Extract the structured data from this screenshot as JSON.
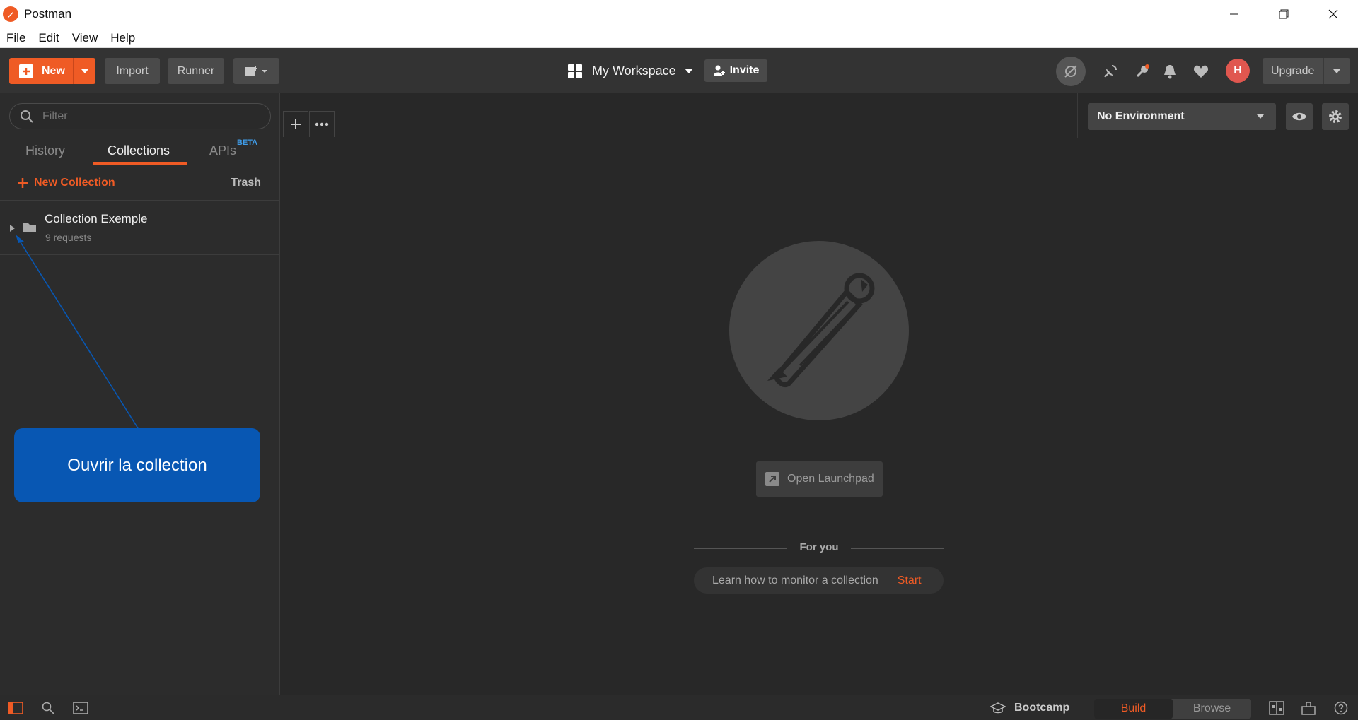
{
  "window": {
    "title": "Postman"
  },
  "menu": [
    "File",
    "Edit",
    "View",
    "Help"
  ],
  "toolbar": {
    "new_label": "New",
    "import_label": "Import",
    "runner_label": "Runner",
    "workspace_label": "My Workspace",
    "invite_label": "Invite",
    "upgrade_label": "Upgrade",
    "avatar_initial": "H"
  },
  "sidebar": {
    "filter_placeholder": "Filter",
    "tabs": {
      "history": "History",
      "collections": "Collections",
      "apis": "APIs",
      "apis_badge": "BETA"
    },
    "active_tab": "Collections",
    "new_collection_label": "New Collection",
    "trash_label": "Trash",
    "collections": [
      {
        "name": "Collection Exemple",
        "subtitle": "9 requests"
      }
    ]
  },
  "callout": {
    "text": "Ouvrir la collection"
  },
  "environment": {
    "selected": "No Environment"
  },
  "main": {
    "launchpad_label": "Open Launchpad",
    "for_you_label": "For you",
    "learn_text": "Learn how to monitor a collection",
    "learn_action": "Start"
  },
  "statusbar": {
    "bootcamp_label": "Bootcamp",
    "build_label": "Build",
    "browse_label": "Browse",
    "active_mode": "Build"
  },
  "colors": {
    "accent": "#ef5b25",
    "callout": "#0857b3",
    "beta": "#3f9ce8"
  }
}
